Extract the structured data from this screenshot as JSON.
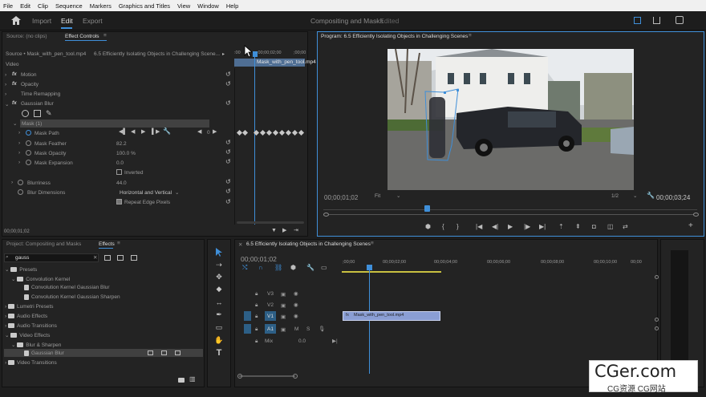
{
  "menu": [
    "File",
    "Edit",
    "Clip",
    "Sequence",
    "Markers",
    "Graphics and Titles",
    "View",
    "Window",
    "Help"
  ],
  "workspace": {
    "import": "Import",
    "edit": "Edit",
    "export": "Export",
    "project_name": "Compositing and Masks",
    "edited": "- Edited"
  },
  "source_panel": {
    "source_tab": "Source: (no clips)",
    "effect_controls_tab": "Effect Controls",
    "master_clip": "Source • Mask_with_pen_tool.mp4",
    "sequence_clip": "6.5 Efficiently Isolating Objects in Challenging Scene...",
    "mini_clip": "Mask_with_pen_tool.mp4",
    "mini_ruler": [
      ":00",
      ";00;00;02;00",
      ";00;00"
    ],
    "section_video": "Video",
    "motion": "Motion",
    "opacity": "Opacity",
    "time_remapping": "Time Remapping",
    "gaussian_blur": "Gaussian Blur",
    "mask": "Mask (1)",
    "mask_path": "Mask Path",
    "mask_feather": "Mask Feather",
    "mask_feather_value": "82.2",
    "mask_opacity": "Mask Opacity",
    "mask_opacity_value": "100.0 %",
    "mask_expansion": "Mask Expansion",
    "mask_expansion_value": "0.0",
    "inverted": "Inverted",
    "blurriness": "Blurriness",
    "blurriness_value": "44.0",
    "blur_dimensions": "Blur Dimensions",
    "blur_dimensions_value": "Horizontal and Vertical",
    "repeat_edge": "Repeat Edge Pixels",
    "path_track_value": "0",
    "timecode": "00;00;01;02"
  },
  "program": {
    "title": "Program: 6.5 Efficiently Isolating Objects in Challenging Scenes",
    "timecode": "00;00;01;02",
    "fit": "Fit",
    "resolution": "1/2",
    "duration": "00;00;03;24"
  },
  "project_panel": {
    "project_tab": "Project: Compositing and Masks",
    "effects_tab": "Effects",
    "search_value": "gauss",
    "items": [
      {
        "label": "Presets",
        "indent": 0,
        "type": "folder",
        "open": true
      },
      {
        "label": "Convolution Kernel",
        "indent": 1,
        "type": "folder",
        "open": true
      },
      {
        "label": "Convolution Kernel Gaussian Blur",
        "indent": 2,
        "type": "preset"
      },
      {
        "label": "Convolution Kernel Gaussian Sharpen",
        "indent": 2,
        "type": "preset"
      },
      {
        "label": "Lumetri Presets",
        "indent": 0,
        "type": "folder",
        "open": false
      },
      {
        "label": "Audio Effects",
        "indent": 0,
        "type": "folder",
        "open": false
      },
      {
        "label": "Audio Transitions",
        "indent": 0,
        "type": "folder",
        "open": false
      },
      {
        "label": "Video Effects",
        "indent": 0,
        "type": "folder",
        "open": true
      },
      {
        "label": "Blur & Sharpen",
        "indent": 1,
        "type": "folder",
        "open": true
      },
      {
        "label": "Gaussian Blur",
        "indent": 2,
        "type": "effect",
        "selected": true
      },
      {
        "label": "Video Transitions",
        "indent": 0,
        "type": "folder",
        "open": false
      }
    ]
  },
  "timeline": {
    "title": "6.5 Efficiently Isolating Objects in Challenging Scenes",
    "timecode": "00;00;01;02",
    "ruler": [
      ";00;00",
      "00;00;02;00",
      "00;00;04;00",
      "00;00;06;00",
      "00;00;08;00",
      "00;00;10;00",
      "00;00;12;00",
      "00;00"
    ],
    "tracks": [
      "V3",
      "V2",
      "V1",
      "A1"
    ],
    "mix_label": "Mix",
    "mix_value": "0.0",
    "clip_name": "Mask_with_pen_tool.mp4",
    "mute": "M",
    "solo": "S"
  },
  "watermark": {
    "main": "CGer.com",
    "sub": "CG资源 CG网站"
  }
}
